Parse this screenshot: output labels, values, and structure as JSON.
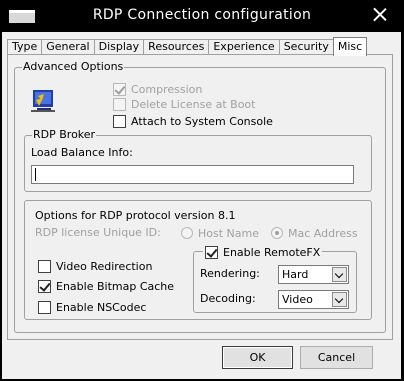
{
  "window": {
    "title": "RDP Connection configuration"
  },
  "tabs": [
    {
      "label": "Type",
      "active": false
    },
    {
      "label": "General",
      "active": false
    },
    {
      "label": "Display",
      "active": false
    },
    {
      "label": "Resources",
      "active": false
    },
    {
      "label": "Experience",
      "active": false
    },
    {
      "label": "Security",
      "active": false
    },
    {
      "label": "Misc",
      "active": true
    }
  ],
  "advanced": {
    "title": "Advanced Options",
    "compression": {
      "label": "Compression",
      "checked": true,
      "enabled": false
    },
    "delete_license": {
      "label": "Delete License at Boot",
      "checked": false,
      "enabled": false
    },
    "attach_console": {
      "label": "Attach to System Console",
      "checked": false,
      "enabled": true
    }
  },
  "broker": {
    "title": "RDP Broker",
    "load_balance_label": "Load Balance Info:",
    "load_balance_value": ""
  },
  "protocol": {
    "title": "Options for RDP protocol version 8.1",
    "license_id_label": "RDP license Unique ID:",
    "host_name_label": "Host Name",
    "mac_address_label": "Mac Address",
    "selected_license_option": "Mac Address",
    "video_redirection": {
      "label": "Video Redirection",
      "checked": false
    },
    "bitmap_cache": {
      "label": "Enable Bitmap Cache",
      "checked": true
    },
    "nscodec": {
      "label": "Enable NSCodec",
      "checked": false
    },
    "remotefx": {
      "label": "Enable RemoteFX",
      "checked": true,
      "rendering_label": "Rendering:",
      "rendering_value": "Hard",
      "decoding_label": "Decoding:",
      "decoding_value": "Video"
    }
  },
  "buttons": {
    "ok": "OK",
    "cancel": "Cancel"
  },
  "colors": {
    "titlebar": "#000000",
    "dialog": "#f0f0f0",
    "icon_blue": "#1f3fb0",
    "icon_yellow": "#f2c200"
  }
}
